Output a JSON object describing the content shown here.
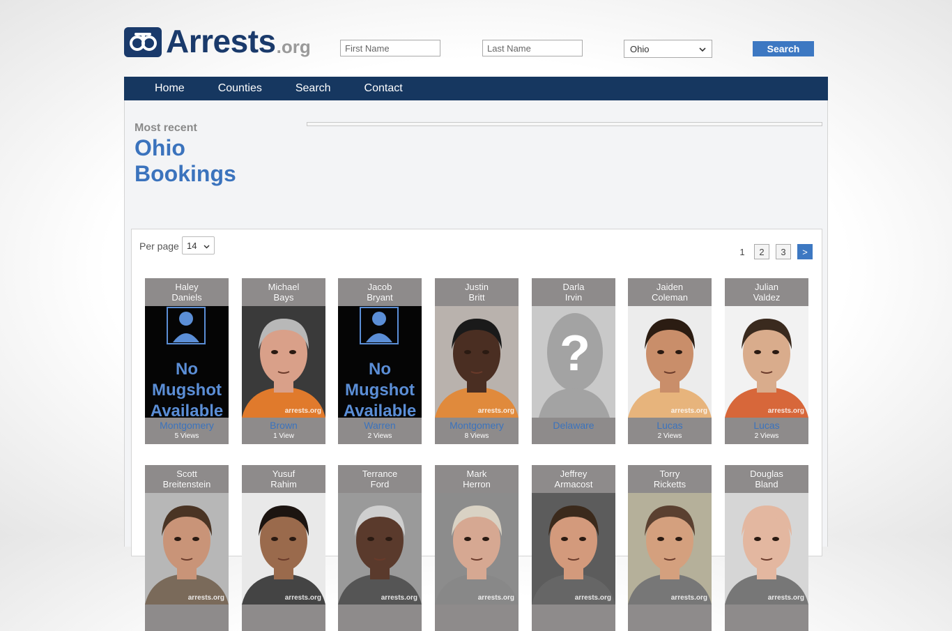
{
  "logo": {
    "main": "Arrests",
    "suffix": ".org"
  },
  "search": {
    "first_placeholder": "First Name",
    "last_placeholder": "Last Name",
    "state": "Ohio",
    "button": "Search"
  },
  "nav": [
    "Home",
    "Counties",
    "Search",
    "Contact"
  ],
  "page": {
    "kicker": "Most recent",
    "title_line1": "Ohio",
    "title_line2": "Bookings"
  },
  "controls": {
    "per_page_label": "Per page",
    "per_page_value": "14",
    "pages": [
      "1",
      "2",
      "3"
    ],
    "next": ">"
  },
  "bookings": [
    {
      "first": "Haley",
      "last": "Daniels",
      "county": "Montgomery",
      "views": "5 Views",
      "photo": "no-mugshot"
    },
    {
      "first": "Michael",
      "last": "Bays",
      "county": "Brown",
      "views": "1 View",
      "photo": "mugshot",
      "skin": "#d9a089",
      "hair": "#b8b8b8",
      "shirt": "#e07a2c",
      "bg": "#3a3a3a"
    },
    {
      "first": "Jacob",
      "last": "Bryant",
      "county": "Warren",
      "views": "2 Views",
      "photo": "no-mugshot"
    },
    {
      "first": "Justin",
      "last": "Britt",
      "county": "Montgomery",
      "views": "8 Views",
      "photo": "mugshot",
      "skin": "#4a2e22",
      "hair": "#1a1a1a",
      "shirt": "#e08a3c",
      "bg": "#b9b2ad"
    },
    {
      "first": "Darla",
      "last": "Irvin",
      "county": "Delaware",
      "views": "",
      "photo": "unknown"
    },
    {
      "first": "Jaiden",
      "last": "Coleman",
      "county": "Lucas",
      "views": "2 Views",
      "photo": "mugshot",
      "skin": "#c98e6a",
      "hair": "#2b1c12",
      "shirt": "#e7b47c",
      "bg": "#ececec"
    },
    {
      "first": "Julian",
      "last": "Valdez",
      "county": "Lucas",
      "views": "2 Views",
      "photo": "mugshot",
      "skin": "#d9ac8c",
      "hair": "#3a2a1e",
      "shirt": "#d7673a",
      "bg": "#f2f2f2"
    },
    {
      "first": "Scott",
      "last": "Breitenstein",
      "county": "",
      "views": "",
      "photo": "mugshot",
      "skin": "#c99478",
      "hair": "#4a3424",
      "shirt": "#7a6a5a",
      "bg": "#b7b7b7"
    },
    {
      "first": "Yusuf",
      "last": "Rahim",
      "county": "",
      "views": "",
      "photo": "mugshot",
      "skin": "#9a6a4c",
      "hair": "#1c1410",
      "shirt": "#444",
      "bg": "#e9e9e9"
    },
    {
      "first": "Terrance",
      "last": "Ford",
      "county": "",
      "views": "",
      "photo": "mugshot",
      "skin": "#5a3a2c",
      "hair": "#cfcfcf",
      "shirt": "#555",
      "bg": "#9a9a9a"
    },
    {
      "first": "Mark",
      "last": "Herron",
      "county": "",
      "views": "",
      "photo": "mugshot",
      "skin": "#d6a892",
      "hair": "#d9d2c4",
      "shirt": "#888",
      "bg": "#8c8c8c"
    },
    {
      "first": "Jeffrey",
      "last": "Armacost",
      "county": "",
      "views": "",
      "photo": "mugshot",
      "skin": "#d39a7c",
      "hair": "#3b2a1c",
      "shirt": "#666",
      "bg": "#5c5c5c"
    },
    {
      "first": "Torry",
      "last": "Ricketts",
      "county": "",
      "views": "",
      "photo": "mugshot",
      "skin": "#d4a07e",
      "hair": "#5a4030",
      "shirt": "#777",
      "bg": "#b5b09a"
    },
    {
      "first": "Douglas",
      "last": "Bland",
      "county": "",
      "views": "",
      "photo": "mugshot",
      "skin": "#e3b7a0",
      "hair": "#e3b7a0",
      "shirt": "#777",
      "bg": "#d6d6d6"
    }
  ],
  "photo_watermark": "arrests.org",
  "no_mugshot_text": [
    "No",
    "Mugshot",
    "Available"
  ],
  "colors": {
    "brand": "#1a3a6b",
    "nav": "#163760",
    "accent": "#3d78c2",
    "link": "#3b73bd"
  }
}
